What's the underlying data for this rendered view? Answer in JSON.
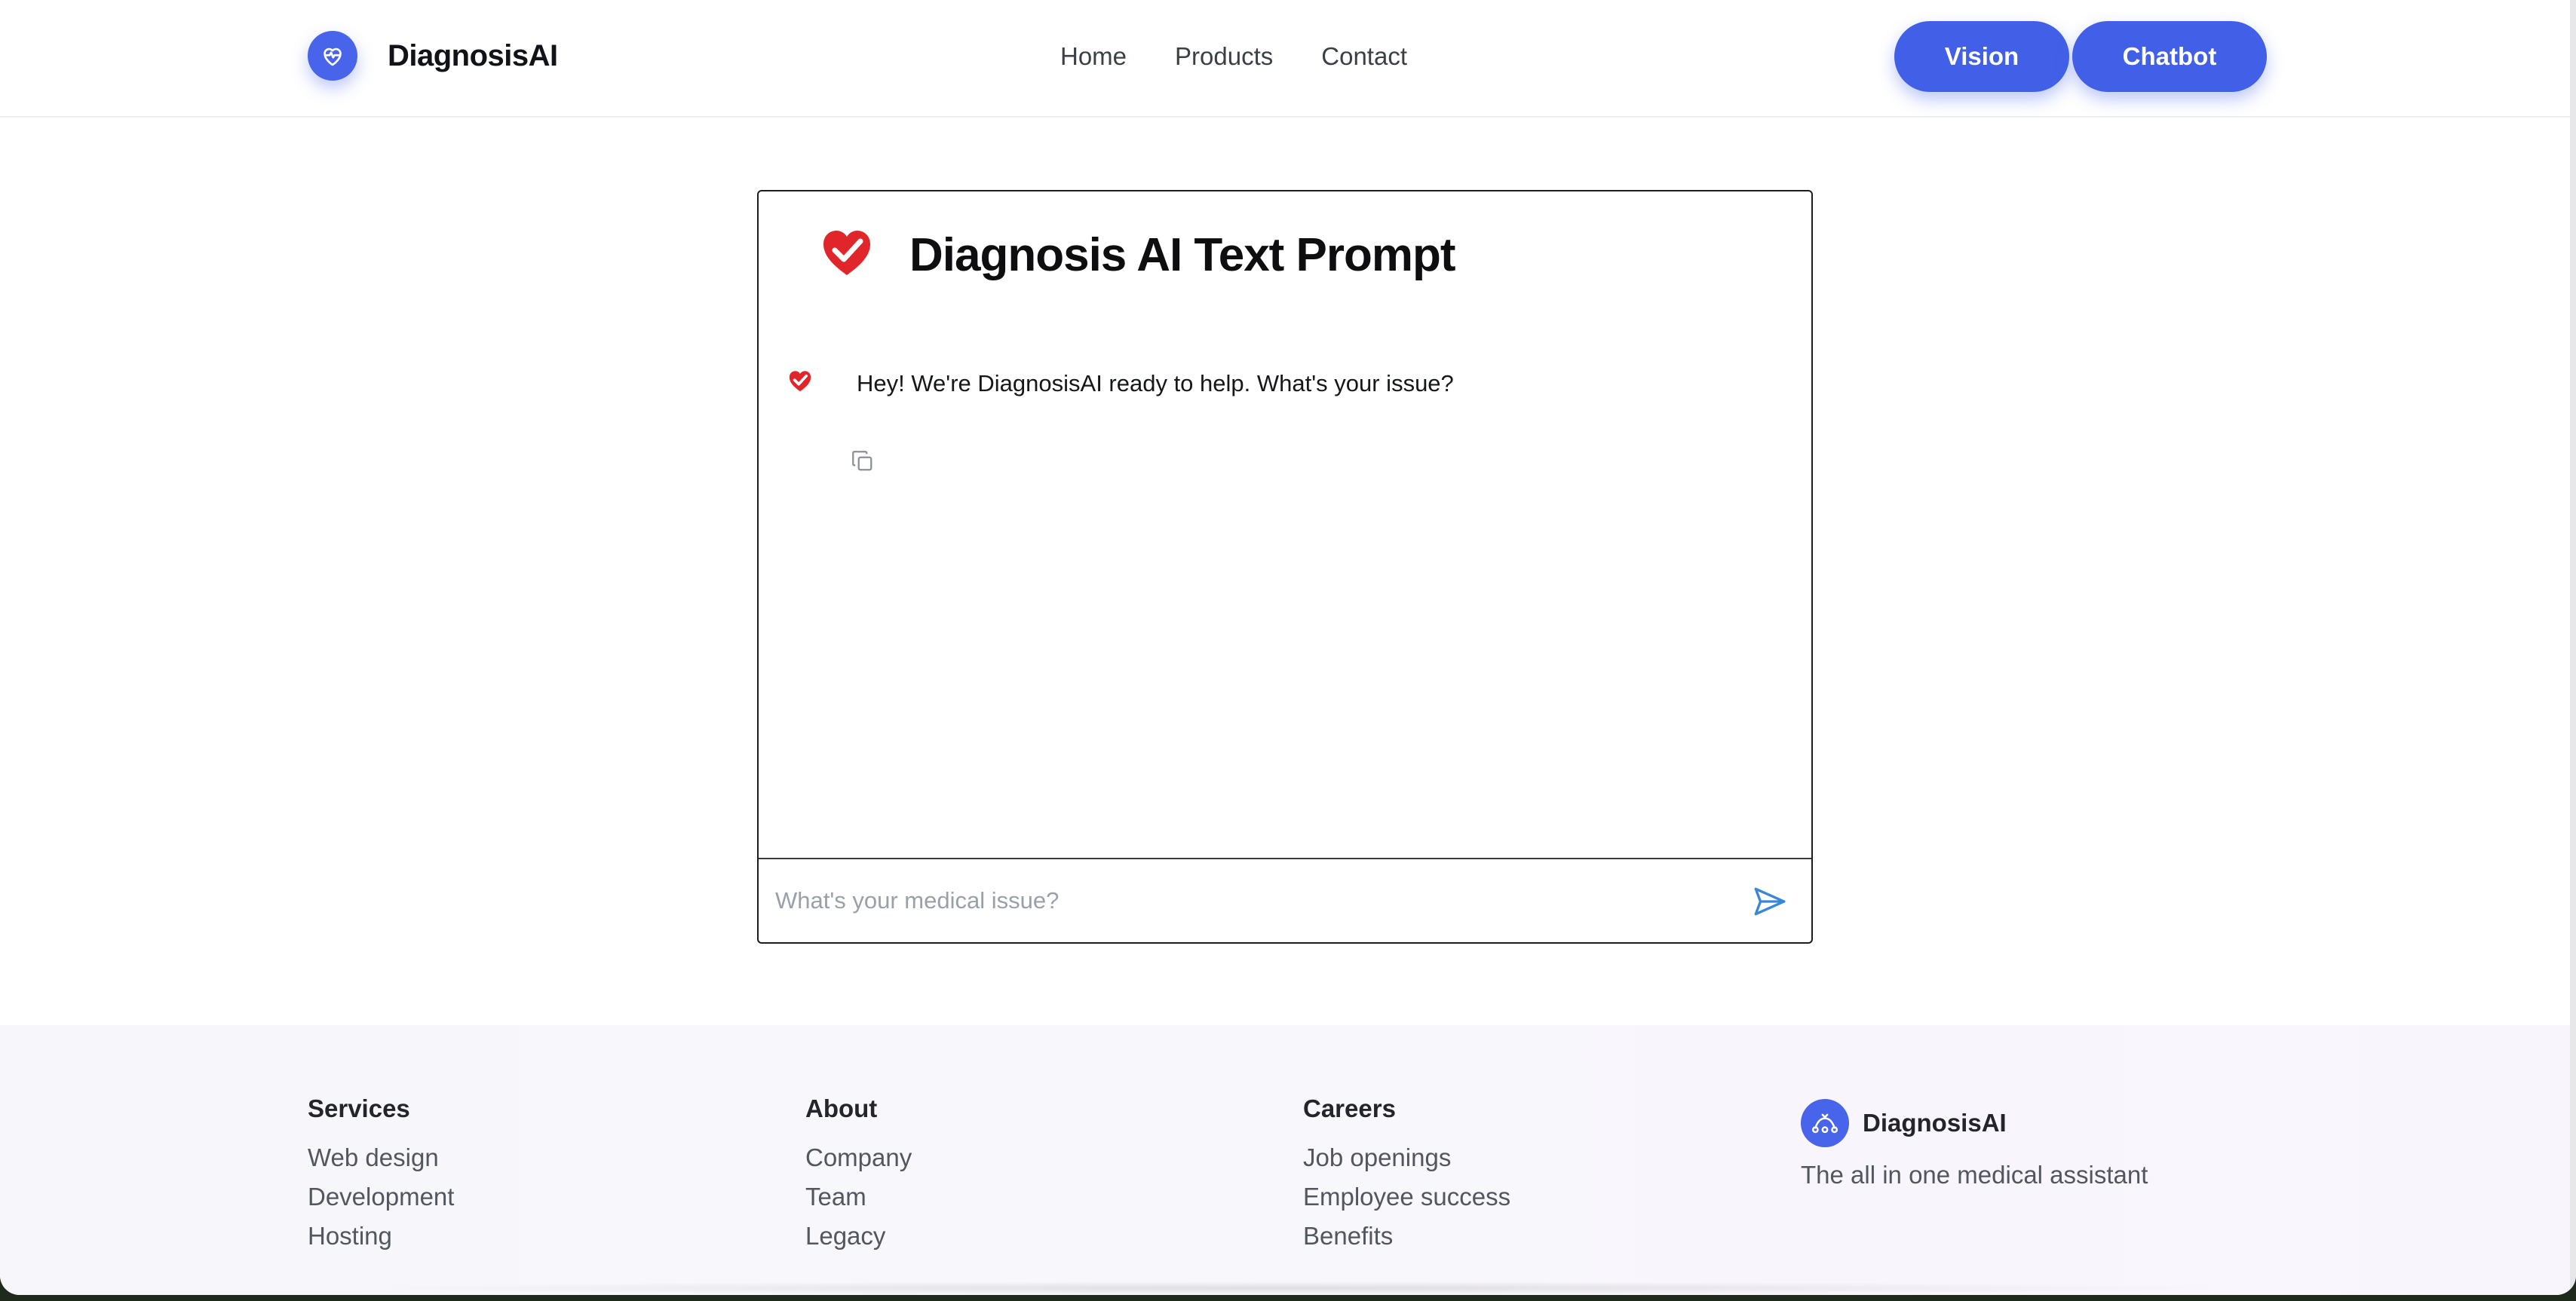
{
  "header": {
    "brand_name": "DiagnosisAI",
    "nav": [
      {
        "label": "Home"
      },
      {
        "label": "Products"
      },
      {
        "label": "Contact"
      }
    ],
    "buttons": {
      "vision_label": "Vision",
      "chatbot_label": "Chatbot"
    }
  },
  "chat": {
    "title": "Diagnosis AI Text Prompt",
    "messages": [
      {
        "sender": "bot",
        "text": "Hey! We're DiagnosisAI ready to help. What's your issue?"
      }
    ],
    "input_placeholder": "What's your medical issue?",
    "input_value": ""
  },
  "footer": {
    "columns": [
      {
        "heading": "Services",
        "links": [
          "Web design",
          "Development",
          "Hosting"
        ]
      },
      {
        "heading": "About",
        "links": [
          "Company",
          "Team",
          "Legacy"
        ]
      },
      {
        "heading": "Careers",
        "links": [
          "Job openings",
          "Employee success",
          "Benefits"
        ]
      }
    ],
    "brand_name": "DiagnosisAI",
    "tagline": "The all in one medical assistant"
  },
  "icons": {
    "brand_logo": "heart-pulse-icon",
    "chat_logo": "heart-check-icon",
    "bot_avatar": "heart-check-icon",
    "copy": "copy-icon",
    "send": "send-icon",
    "footer_logo": "stethoscope-icon"
  },
  "colors": {
    "accent": "#4160e7",
    "heart_red": "#e0262b",
    "send_blue": "#3a86d8"
  }
}
